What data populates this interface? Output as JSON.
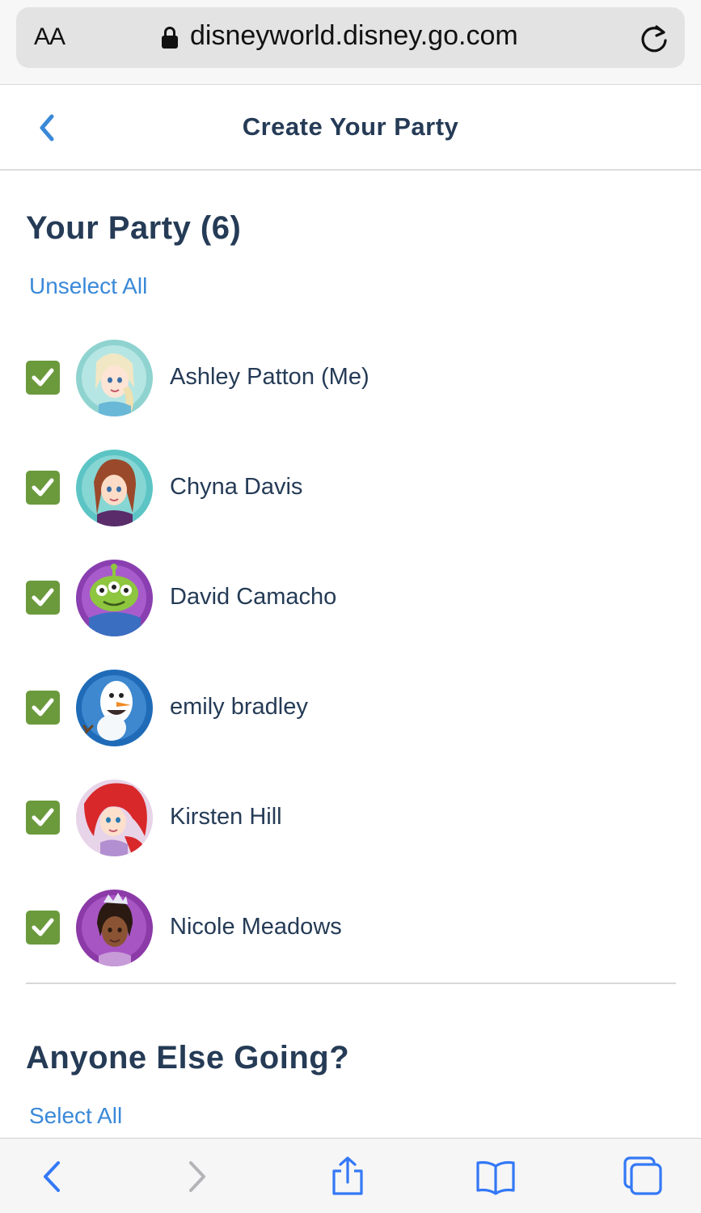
{
  "browser": {
    "text_size_label": "AA",
    "url": "disneyworld.disney.go.com",
    "icons": [
      "text-size-icon",
      "lock-icon",
      "reload-icon"
    ]
  },
  "header": {
    "title": "Create Your Party",
    "back_icon": "chevron-left-icon"
  },
  "party": {
    "title": "Your Party (6)",
    "unselect_all": "Unselect All",
    "members": [
      {
        "name": "Ashley Patton (Me)",
        "checked": true,
        "avatar": "elsa-avatar"
      },
      {
        "name": "Chyna Davis",
        "checked": true,
        "avatar": "anna-avatar"
      },
      {
        "name": "David Camacho",
        "checked": true,
        "avatar": "alien-avatar"
      },
      {
        "name": "emily bradley",
        "checked": true,
        "avatar": "olaf-avatar"
      },
      {
        "name": "Kirsten Hill",
        "checked": true,
        "avatar": "ariel-avatar"
      },
      {
        "name": "Nicole Meadows",
        "checked": true,
        "avatar": "tiana-avatar"
      }
    ]
  },
  "others": {
    "title": "Anyone Else Going?",
    "select_all": "Select All"
  },
  "toolbar": {
    "icons": [
      "back-icon",
      "forward-icon",
      "share-icon",
      "bookmarks-icon",
      "tabs-icon"
    ]
  },
  "colors": {
    "primary_text": "#253b56",
    "link": "#3a89d8",
    "checkbox": "#6b9a3d"
  }
}
